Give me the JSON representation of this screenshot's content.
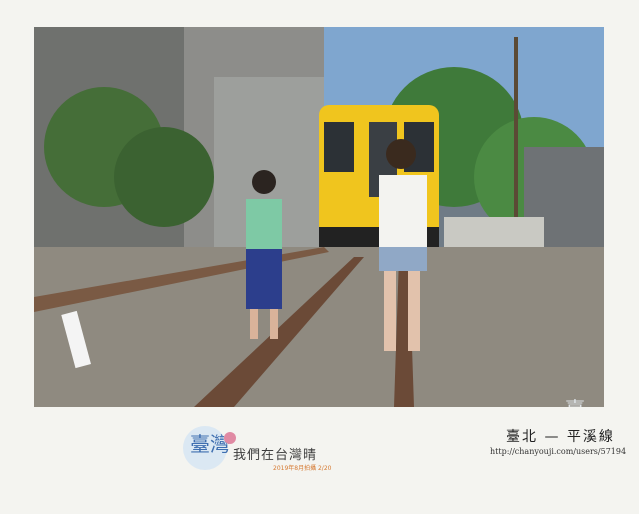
{
  "photo": {
    "description_icon": "photo-icon",
    "watermark": "臺灣"
  },
  "logo": {
    "main": "臺灣",
    "slogan": "我們在台灣晴",
    "date": "2019年8月拍攝 2/20"
  },
  "caption": {
    "title": "臺北 — 平溪線",
    "url": "http://chanyouji.com/users/57194"
  },
  "colors": {
    "train_yellow": "#f0c51e",
    "sky": "#5f89b8",
    "foliage": "#3f7a3a"
  }
}
